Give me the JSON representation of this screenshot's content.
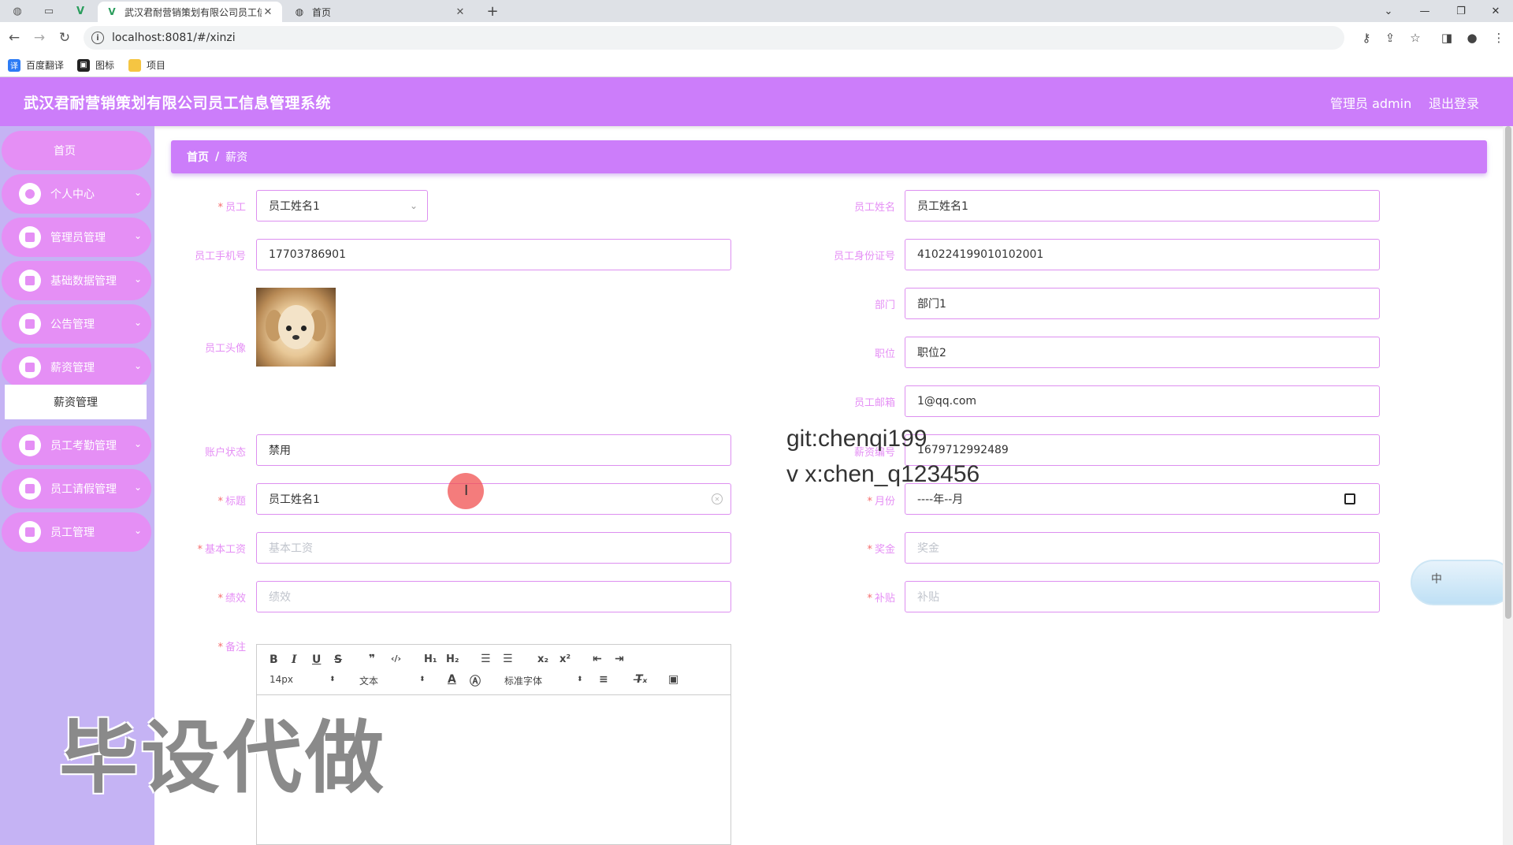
{
  "browser": {
    "tabs": [
      {
        "title": "武汉君耐营销策划有限公司员工信",
        "active": true
      },
      {
        "title": "首页",
        "active": false
      }
    ],
    "url": "localhost:8081/#/xinzi",
    "bookmarks": [
      {
        "label": "百度翻译",
        "icon": "translate-icon",
        "color": "#2d7cf5"
      },
      {
        "label": "图标",
        "icon": "image-icon",
        "color": "#222222"
      },
      {
        "label": "项目",
        "icon": "folder-icon",
        "color": "#f5c542"
      }
    ]
  },
  "header": {
    "title": "武汉君耐营销策划有限公司员工信息管理系统",
    "user": "管理员 admin",
    "logout": "退出登录",
    "color": "#cc7dfa"
  },
  "sidebar": {
    "home": "首页",
    "items": [
      {
        "label": "个人中心",
        "icon": "user-icon"
      },
      {
        "label": "管理员管理",
        "icon": "check-icon"
      },
      {
        "label": "基础数据管理",
        "icon": "clipboard-icon"
      },
      {
        "label": "公告管理",
        "icon": "grid-icon"
      },
      {
        "label": "薪资管理",
        "icon": "grid-icon"
      },
      {
        "label": "员工考勤管理",
        "icon": "grid-icon"
      },
      {
        "label": "员工请假管理",
        "icon": "chat-icon"
      },
      {
        "label": "员工管理",
        "icon": "grid-icon"
      }
    ],
    "submenu_active": "薪资管理"
  },
  "breadcrumb": {
    "home": "首页",
    "separator": "/",
    "current": "薪资"
  },
  "form": {
    "employee": {
      "label": "员工",
      "value": "员工姓名1"
    },
    "employee_name": {
      "label": "员工姓名",
      "value": "员工姓名1"
    },
    "phone": {
      "label": "员工手机号",
      "value": "17703786901"
    },
    "id_card": {
      "label": "员工身份证号",
      "value": "410224199010102001"
    },
    "department": {
      "label": "部门",
      "value": "部门1"
    },
    "avatar": {
      "label": "员工头像"
    },
    "position": {
      "label": "职位",
      "value": "职位2"
    },
    "email": {
      "label": "员工邮箱",
      "value": "1@qq.com"
    },
    "account_status": {
      "label": "账户状态",
      "value": "禁用"
    },
    "salary_no": {
      "label": "薪资编号",
      "value": "1679712992489"
    },
    "title": {
      "label": "标题",
      "value": "员工姓名1"
    },
    "month": {
      "label": "月份",
      "value": "----年--月"
    },
    "base_salary": {
      "label": "基本工资",
      "placeholder": "基本工资"
    },
    "bonus": {
      "label": "奖金",
      "placeholder": "奖金"
    },
    "performance": {
      "label": "绩效",
      "placeholder": "绩效"
    },
    "allowance": {
      "label": "补贴",
      "placeholder": "补贴"
    },
    "remark": {
      "label": "备注"
    }
  },
  "editor": {
    "font_size": "14px",
    "text_type": "文本",
    "font_family": "标准字体"
  },
  "overlays": {
    "git": "git:chenqi199",
    "wechat": "v x:chen_q123456",
    "big_watermark": "毕设代做",
    "ime": "中"
  }
}
